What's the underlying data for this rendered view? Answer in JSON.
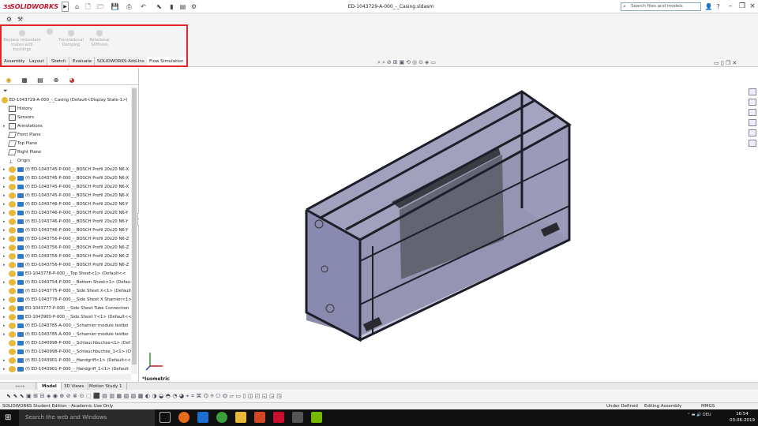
{
  "app": {
    "brand": "SOLIDWORKS",
    "document_title": "ED-1043729-A-000_-_Casing.sldasm",
    "search_placeholder": "Search files and models"
  },
  "ribbon": {
    "buttons": [
      {
        "label": "Replace redundant mates with bushings"
      },
      {
        "label": "Translational Damping"
      },
      {
        "label": "Rotational Stiffness"
      }
    ],
    "tabs": [
      "Assembly",
      "Layout",
      "Sketch",
      "Evaluate",
      "SOLIDWORKS Add-Ins",
      "Flow Simulation"
    ],
    "active_tab": "Flow Simulation"
  },
  "tree": {
    "root": "ED-1043729-A-000_-_Casing  (Default<Display State-1>)",
    "items": [
      {
        "label": "History",
        "icon": "folder",
        "exp": ""
      },
      {
        "label": "Sensors",
        "icon": "folder",
        "exp": ""
      },
      {
        "label": "Annotations",
        "icon": "folder",
        "exp": "▸"
      },
      {
        "label": "Front Plane",
        "icon": "plane",
        "exp": ""
      },
      {
        "label": "Top Plane",
        "icon": "plane",
        "exp": ""
      },
      {
        "label": "Right Plane",
        "icon": "plane",
        "exp": ""
      },
      {
        "label": "Origin",
        "icon": "pt",
        "exp": ""
      },
      {
        "label": "(f) ED-1043745-P-000_-_BOSCH Profil 20x20 N6-X",
        "icon": "part",
        "exp": "▸"
      },
      {
        "label": "(f) ED-1043745-P-000_-_BOSCH Profil 20x20 N6-X",
        "icon": "part",
        "exp": "▸"
      },
      {
        "label": "(f) ED-1043745-P-000_-_BOSCH Profil 20x20 N6-X",
        "icon": "part",
        "exp": "▸"
      },
      {
        "label": "(f) ED-1043745-P-000_-_BOSCH Profil 20x20 N6-X",
        "icon": "part",
        "exp": "▸"
      },
      {
        "label": "(f) ED-1043746-P-000_-_BOSCH Profil 20x20 N6-Y",
        "icon": "part",
        "exp": "▸"
      },
      {
        "label": "(f) ED-1043746-P-000_-_BOSCH Profil 20x20 N6-Y",
        "icon": "part",
        "exp": "▸"
      },
      {
        "label": "(f) ED-1043746-P-000_-_BOSCH Profil 20x20 N6-Y",
        "icon": "part",
        "exp": "▸"
      },
      {
        "label": "(f) ED-1043746-P-000_-_BOSCH Profil 20x20 N6-Y",
        "icon": "part",
        "exp": "▸"
      },
      {
        "label": "(f) ED-1043756-P-000_-_BOSCH Profil 20x20 N6-Z",
        "icon": "part",
        "exp": "▸"
      },
      {
        "label": "(f) ED-1043756-P-000_-_BOSCH Profil 20x20 N6-Z",
        "icon": "part",
        "exp": "▸"
      },
      {
        "label": "(f) ED-1043756-P-000_-_BOSCH Profil 20x20 N6-Z",
        "icon": "part",
        "exp": "▸"
      },
      {
        "label": "(f) ED-1043756-P-000_-_BOSCH Profil 20x20 N6-Z",
        "icon": "part",
        "exp": "▸"
      },
      {
        "label": "ED-1043778-P-000_-_Top Sheet<1> (Default<<",
        "icon": "part",
        "exp": ""
      },
      {
        "label": "(f) ED-1043754-P-000_-_Bottom Sheet<1> (Defau",
        "icon": "part",
        "exp": "▸"
      },
      {
        "label": "(f) ED-1043775-P-000_-_Side Sheet X<1> (Default",
        "icon": "part",
        "exp": ""
      },
      {
        "label": "(f) ED-1043776-P-000_-_Side Sheet X Sharnier<1>",
        "icon": "part",
        "exp": "▸"
      },
      {
        "label": "ED-1043777-P-000_-_Side Sheet Tube Connection",
        "icon": "part",
        "exp": "▸"
      },
      {
        "label": "ED-1043900-P-000_-_Side Sheet Y<1> (Default<<",
        "icon": "part",
        "exp": "▸"
      },
      {
        "label": "(f) ED-1043785-A-000_-_Scharnier module testbo",
        "icon": "part",
        "exp": "▸"
      },
      {
        "label": "(f) ED-1043785-A-000_-_Scharnier module testbo",
        "icon": "part",
        "exp": "▸"
      },
      {
        "label": "(f) ED-1040998-P-000_-_Schlauchbuchse<1> (Def",
        "icon": "part",
        "exp": ""
      },
      {
        "label": "(f) ED-1040998-P-000_-_Schlauchbuchse_1<1> (D",
        "icon": "part",
        "exp": ""
      },
      {
        "label": "(f) ED-1043901-P-000_-_Handgriff<1> (Default<<",
        "icon": "part",
        "exp": "▸"
      },
      {
        "label": "(f) ED-1043901-P-000_-_Handgriff_1<1> (Default",
        "icon": "part",
        "exp": "▸"
      }
    ]
  },
  "viewport": {
    "view_label": "*Isometric"
  },
  "bottom_tabs": [
    "Model",
    "3D Views",
    "Motion Study 1"
  ],
  "status": {
    "left": "SOLIDWORKS Student Edition - Academic Use Only",
    "under_defined": "Under Defined",
    "mode": "Editing Assembly",
    "units": "MMGS"
  },
  "taskbar": {
    "search_placeholder": "Search the web and Windows",
    "lang": "DEU",
    "time": "16:54",
    "date": "03-06-2019"
  },
  "colors": {
    "highlight_box": "#e3242b",
    "brand_red": "#c8102e"
  }
}
